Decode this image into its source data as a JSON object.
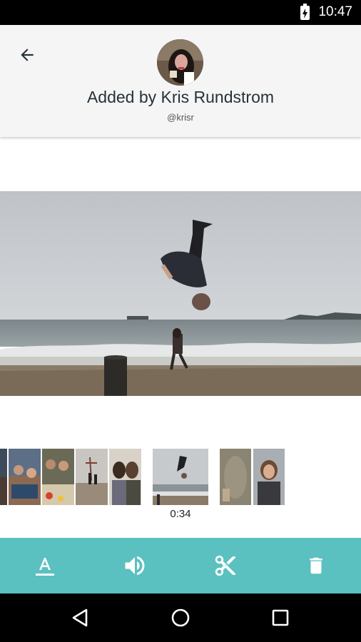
{
  "status_bar": {
    "time": "10:47",
    "icons": [
      "battery-charging-icon"
    ]
  },
  "header": {
    "back_icon": "arrow-left-icon",
    "title": "Added by Kris Rundstrom",
    "handle": "@krisr"
  },
  "video": {
    "scene": "backflip-on-beach"
  },
  "timeline": {
    "selected_duration": "0:34",
    "thumbnails": [
      "clip-1",
      "clip-2",
      "clip-3",
      "clip-4",
      "clip-5",
      "clip-6-selected",
      "clip-7",
      "clip-8"
    ]
  },
  "toolbar": {
    "items": [
      "text-format-icon",
      "volume-icon",
      "scissors-icon",
      "trash-icon"
    ],
    "color": "#5bc0c0"
  },
  "nav_bar": {
    "items": [
      "back-triangle-icon",
      "home-circle-icon",
      "recents-square-icon"
    ]
  }
}
